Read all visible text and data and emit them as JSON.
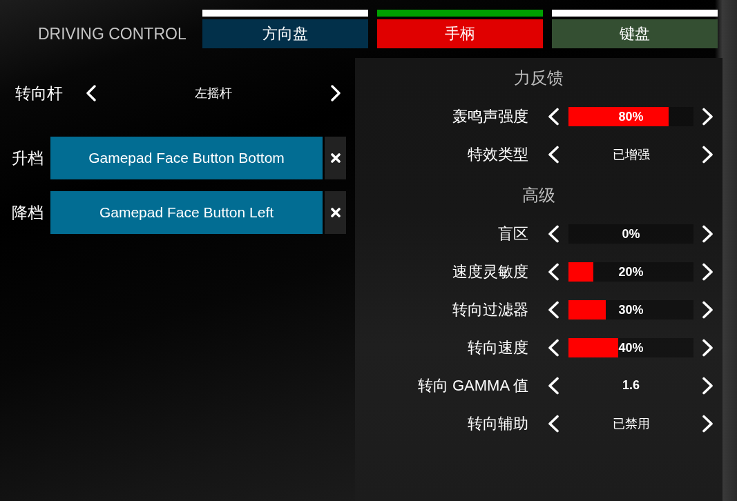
{
  "title": "DRIVING CONTROL",
  "tabs": [
    {
      "label": "方向盘",
      "selected": false,
      "color": "#02304a"
    },
    {
      "label": "手柄",
      "selected": true,
      "color": "#e00000"
    },
    {
      "label": "键盘",
      "selected": false,
      "color": "#344f32"
    }
  ],
  "controls": {
    "steering": {
      "label": "转向杆",
      "value": "左摇杆"
    },
    "bindings": [
      {
        "label": "升档",
        "key": "Gamepad Face Button Bottom"
      },
      {
        "label": "降档",
        "key": "Gamepad Face Button Left"
      }
    ]
  },
  "settings": [
    {
      "heading": "力反馈",
      "rows": [
        {
          "kind": "slider",
          "label": "轰鸣声强度",
          "level": 0.8,
          "reading": "80%"
        },
        {
          "kind": "option",
          "label": "特效类型",
          "value": "已增强"
        }
      ]
    },
    {
      "heading": "高级",
      "rows": [
        {
          "kind": "slider",
          "label": "盲区",
          "reading": "0%"
        },
        {
          "kind": "slider",
          "label": "速度灵敏度",
          "level": 0.2,
          "reading": "20%"
        },
        {
          "kind": "slider",
          "label": "转向过滤器",
          "level": 0.3,
          "reading": "30%"
        },
        {
          "kind": "slider",
          "label": "转向速度",
          "level": 0.4,
          "reading": "40%"
        },
        {
          "kind": "number",
          "label": "转向 GAMMA 值",
          "value": "1.6"
        },
        {
          "kind": "option",
          "label": "转向辅助",
          "value": "已禁用"
        }
      ]
    }
  ]
}
